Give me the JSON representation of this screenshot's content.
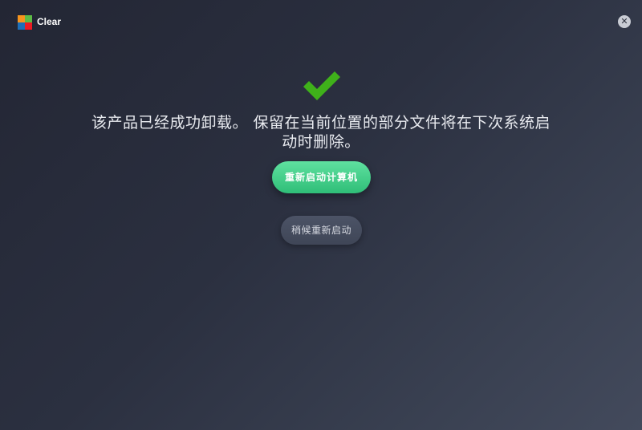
{
  "titlebar": {
    "app_title": "Clear",
    "close_glyph": "✕",
    "logo_colors": [
      "#f7941d",
      "#5dbb46",
      "#1e6fb8",
      "#ed1c24"
    ]
  },
  "main": {
    "status_icon": "checkmark-icon",
    "status_color": "#3fb11a",
    "message_line1": "该产品已经成功卸载。 保留在当前位置的部分文件将在下次系统启",
    "message_line2": "动时删除。",
    "restart_now_label": "重新启动计算机",
    "restart_later_label": "稍候重新启动"
  },
  "colors": {
    "primary_button": "#3cc985",
    "secondary_button": "#464d5f"
  }
}
